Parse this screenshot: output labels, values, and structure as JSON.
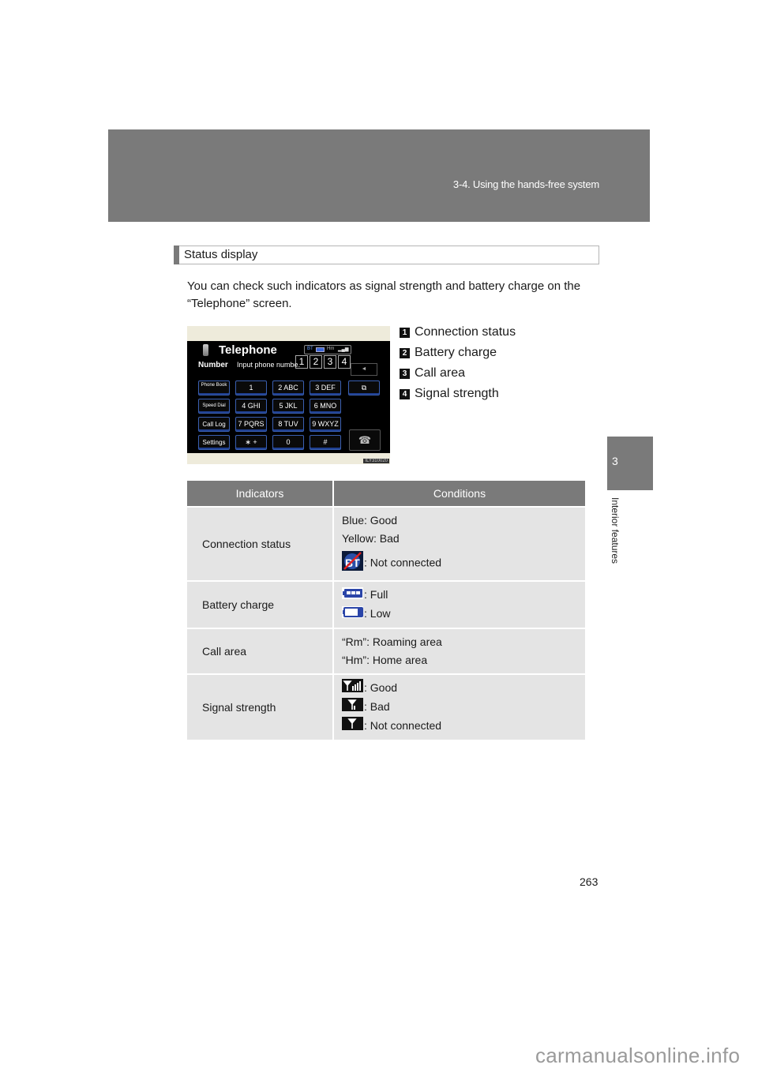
{
  "header": {
    "section_title": "3-4. Using the hands-free system"
  },
  "side_tab": {
    "chapter_number": "3",
    "chapter_label": "Interior features"
  },
  "status_display": {
    "heading": "Status display",
    "intro": "You can check such indicators as signal strength and battery charge on the “Telephone” screen."
  },
  "screen": {
    "title": "Telephone",
    "number_label": "Number",
    "input_placeholder": "Input phone numbe.",
    "status_bar": {
      "bt": "BT",
      "area": "Hm"
    },
    "callouts": [
      "1",
      "2",
      "3",
      "4"
    ],
    "back_label": "◄",
    "keys": {
      "phone_book": "Phone Book",
      "speed_dial": "Speed Dial",
      "call_log": "Call Log",
      "settings": "Settings",
      "k1": "1",
      "k2": "2 ABC",
      "k3": "3 DEF",
      "k4": "4 GHI",
      "k5": "5 JKL",
      "k6": "6 MNO",
      "k7": "7 PQRS",
      "k8": "8 TUV",
      "k9": "9 WXYZ",
      "star": "∗ +",
      "k0": "0",
      "hash": "#",
      "window": "⧉",
      "end_call": "☎"
    },
    "image_code": "ILY310020"
  },
  "legend": [
    {
      "num": "1",
      "label": "Connection status"
    },
    {
      "num": "2",
      "label": "Battery charge"
    },
    {
      "num": "3",
      "label": "Call area"
    },
    {
      "num": "4",
      "label": "Signal strength"
    }
  ],
  "table": {
    "headers": [
      "Indicators",
      "Conditions"
    ],
    "rows": [
      {
        "indicator": "Connection status",
        "conditions": [
          "Blue: Good",
          "Yellow: Bad",
          ": Not connected"
        ]
      },
      {
        "indicator": "Battery charge",
        "conditions": [
          ": Full",
          ": Low"
        ]
      },
      {
        "indicator": "Call area",
        "conditions": [
          "“Rm”: Roaming area",
          "“Hm”: Home area"
        ]
      },
      {
        "indicator": "Signal strength",
        "conditions": [
          ": Good",
          ": Bad",
          ": Not connected"
        ]
      }
    ]
  },
  "page_number": "263",
  "watermark": "carmanualsonline.info"
}
